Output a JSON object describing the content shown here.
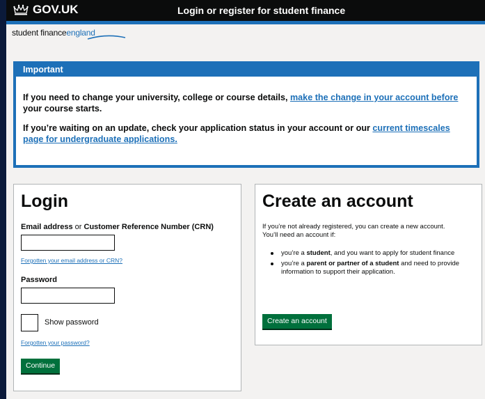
{
  "header": {
    "logo_text": "GOV.UK",
    "title": "Login or register for student finance"
  },
  "brand": {
    "part1": "student finance",
    "part2": "england"
  },
  "important": {
    "heading": "Important",
    "p1_text": "If you need to change your university, college or course details, ",
    "p1_link": "make the change in your account before",
    "p1_after": " your course starts.",
    "p2_text": "If you’re waiting on an update, check your application status in your account or our ",
    "p2_link": "current timescales page for undergraduate applications."
  },
  "login": {
    "title": "Login",
    "email_label_part1": "Email address",
    "email_label_or": " or ",
    "email_label_part2": "Customer Reference Number (CRN)",
    "forgot_email": "Forgotten your email address or CRN?",
    "password_label": "Password",
    "show_password": "Show password",
    "forgot_password": "Forgotten your password?",
    "continue_button": "Continue"
  },
  "create": {
    "title": "Create an account",
    "desc1": "If you’re not already registered, you can create a new account.",
    "desc2": "You’ll need an account if:",
    "item1_pre": "you’re a ",
    "item1_bold": "student",
    "item1_post": ", and you want to apply for student finance",
    "item2_pre": "you’re a ",
    "item2_bold": "parent or partner of a student",
    "item2_post": " and need to provide information to support their application.",
    "button": "Create an account"
  },
  "colors": {
    "header_bg": "#0b0c0c",
    "accent_blue": "#1d70b8",
    "button_green": "#00703c",
    "page_bg": "#f3f2f1"
  }
}
